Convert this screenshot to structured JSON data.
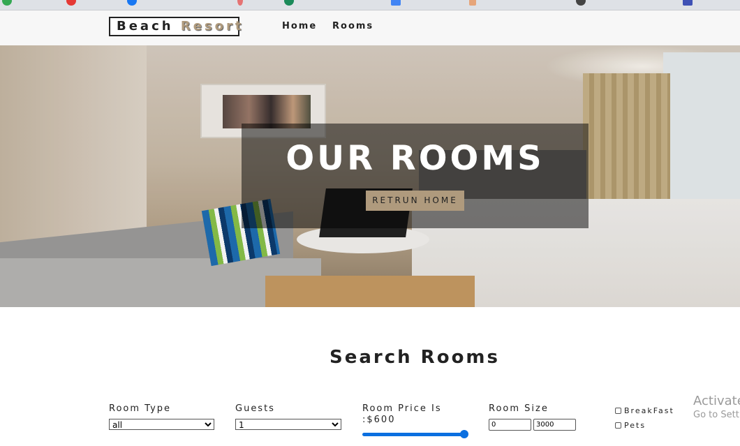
{
  "site": {
    "logo_word1": "Beach",
    "logo_word2": "Resort",
    "nav": {
      "home": "Home",
      "rooms": "Rooms"
    }
  },
  "hero": {
    "title": "OUR ROOMS",
    "button_label": "RETRUN HOME"
  },
  "search": {
    "title": "Search Rooms",
    "room_type": {
      "label": "Room Type",
      "value": "all"
    },
    "guests": {
      "label": "Guests",
      "value": "1"
    },
    "price": {
      "label": "Room Price Is :$600",
      "slider_fraction": 1.0
    },
    "size": {
      "label": "Room Size",
      "min": "0",
      "max": "3000"
    },
    "extras": {
      "breakfast": "BreakFast",
      "pets": "Pets"
    }
  },
  "watermark": {
    "title": "Activate",
    "subtitle": "Go to Sett"
  },
  "colors": {
    "accent": "#af9a7d",
    "nav_bg": "#f7f7f7",
    "slider": "#0b6fe0"
  }
}
